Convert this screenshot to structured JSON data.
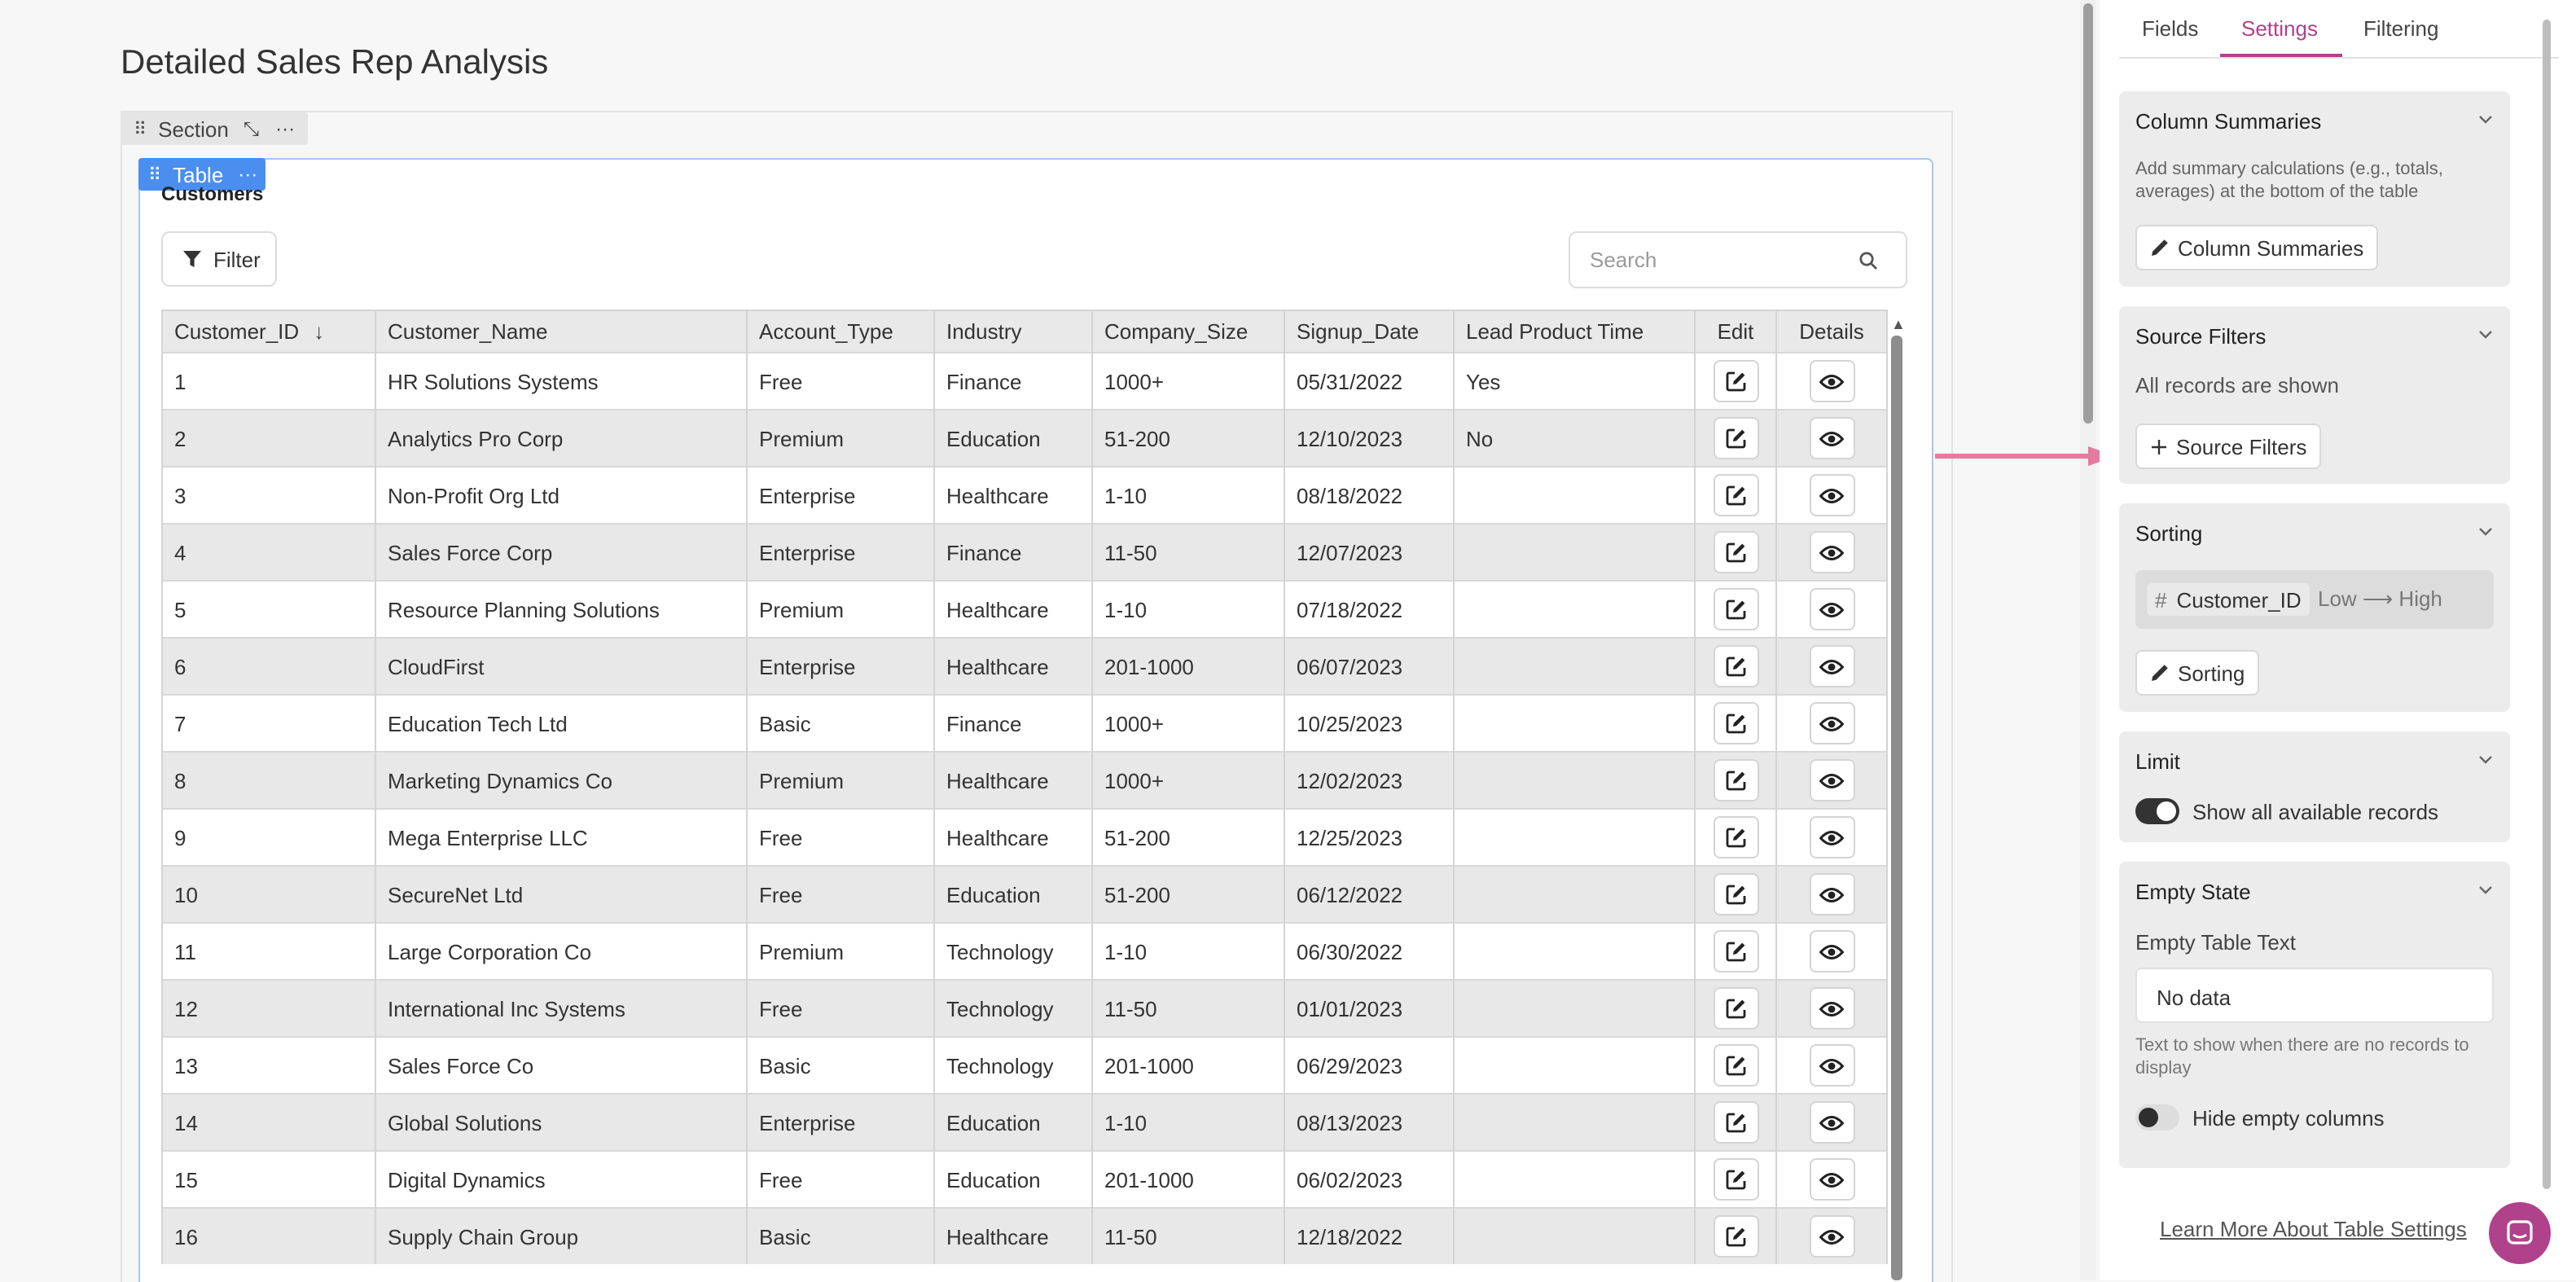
{
  "page": {
    "title": "Detailed Sales Rep Analysis"
  },
  "section": {
    "label": "Section"
  },
  "table_block": {
    "label": "Table",
    "title": "Customers",
    "filter_label": "Filter",
    "search_placeholder": "Search",
    "columns": [
      "Customer_ID",
      "Customer_Name",
      "Account_Type",
      "Industry",
      "Company_Size",
      "Signup_Date",
      "Lead Product Time",
      "Edit",
      "Details"
    ],
    "rows": [
      [
        "1",
        "HR Solutions Systems",
        "Free",
        "Finance",
        "1000+",
        "05/31/2022",
        "Yes"
      ],
      [
        "2",
        "Analytics Pro Corp",
        "Premium",
        "Education",
        "51-200",
        "12/10/2023",
        "No"
      ],
      [
        "3",
        "Non-Profit Org Ltd",
        "Enterprise",
        "Healthcare",
        "1-10",
        "08/18/2022",
        ""
      ],
      [
        "4",
        "Sales Force Corp",
        "Enterprise",
        "Finance",
        "11-50",
        "12/07/2023",
        ""
      ],
      [
        "5",
        "Resource Planning Solutions",
        "Premium",
        "Healthcare",
        "1-10",
        "07/18/2022",
        ""
      ],
      [
        "6",
        "CloudFirst",
        "Enterprise",
        "Healthcare",
        "201-1000",
        "06/07/2023",
        ""
      ],
      [
        "7",
        "Education Tech Ltd",
        "Basic",
        "Finance",
        "1000+",
        "10/25/2023",
        ""
      ],
      [
        "8",
        "Marketing Dynamics Co",
        "Premium",
        "Healthcare",
        "1000+",
        "12/02/2023",
        ""
      ],
      [
        "9",
        "Mega Enterprise LLC",
        "Free",
        "Healthcare",
        "51-200",
        "12/25/2023",
        ""
      ],
      [
        "10",
        "SecureNet Ltd",
        "Free",
        "Education",
        "51-200",
        "06/12/2022",
        ""
      ],
      [
        "11",
        "Large Corporation Co",
        "Premium",
        "Technology",
        "1-10",
        "06/30/2022",
        ""
      ],
      [
        "12",
        "International Inc Systems",
        "Free",
        "Technology",
        "11-50",
        "01/01/2023",
        ""
      ],
      [
        "13",
        "Sales Force Co",
        "Basic",
        "Technology",
        "201-1000",
        "06/29/2023",
        ""
      ],
      [
        "14",
        "Global Solutions",
        "Enterprise",
        "Education",
        "1-10",
        "08/13/2023",
        ""
      ],
      [
        "15",
        "Digital Dynamics",
        "Free",
        "Education",
        "201-1000",
        "06/02/2023",
        ""
      ],
      [
        "16",
        "Supply Chain Group",
        "Basic",
        "Healthcare",
        "11-50",
        "12/18/2022",
        ""
      ]
    ]
  },
  "panel": {
    "tabs": [
      "Fields",
      "Settings",
      "Filtering"
    ],
    "active_tab": "Settings",
    "column_summaries": {
      "header": "Column Summaries",
      "description": "Add summary calculations (e.g., totals, averages) at the bottom of the table",
      "button": "Column Summaries"
    },
    "source_filters": {
      "header": "Source Filters",
      "status": "All records are shown",
      "button": "Source Filters"
    },
    "sorting": {
      "header": "Sorting",
      "field": "Customer_ID",
      "direction": "Low ⟶ High",
      "button": "Sorting"
    },
    "limit": {
      "header": "Limit",
      "toggle_label": "Show all available records",
      "toggle_on": true
    },
    "empty_state": {
      "header": "Empty State",
      "field_label": "Empty Table Text",
      "field_value": "No data",
      "help": "Text to show when there are no records to display",
      "toggle_label": "Hide empty columns",
      "toggle_on": false
    },
    "learn_more": "Learn More About Table Settings"
  },
  "colors": {
    "accent": "#b0428b",
    "table_tab": "#4a8ff0",
    "annotation_arrow": "#e8799f"
  }
}
